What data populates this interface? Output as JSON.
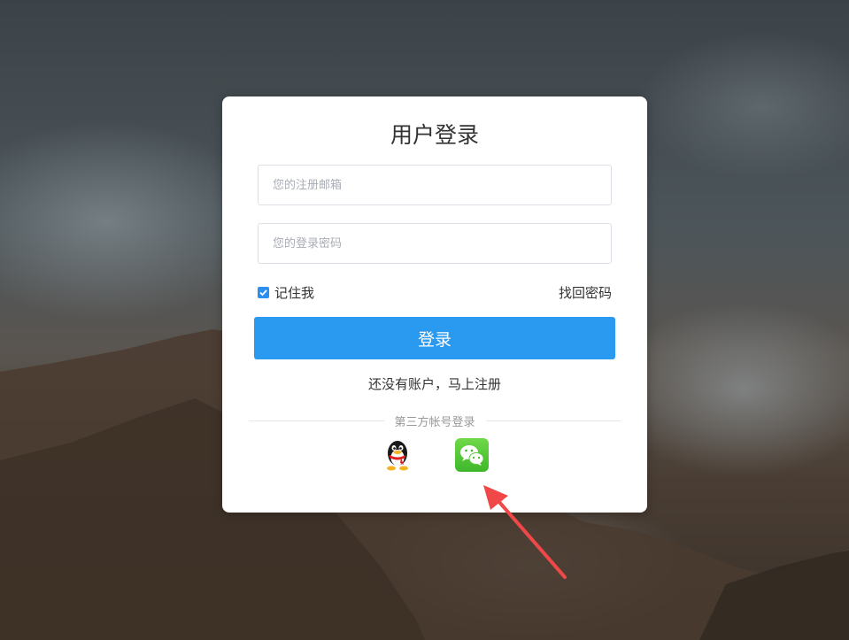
{
  "login": {
    "title": "用户登录",
    "email_placeholder": "您的注册邮箱",
    "password_placeholder": "您的登录密码",
    "remember_label": "记住我",
    "remember_checked": true,
    "forgot_label": "找回密码",
    "login_button": "登录",
    "register_link": "还没有账户，马上注册",
    "third_party_label": "第三方帐号登录"
  },
  "icons": {
    "qq": "qq-penguin-icon",
    "wechat": "wechat-icon"
  },
  "colors": {
    "accent": "#2a9af0",
    "arrow": "#f04848"
  }
}
